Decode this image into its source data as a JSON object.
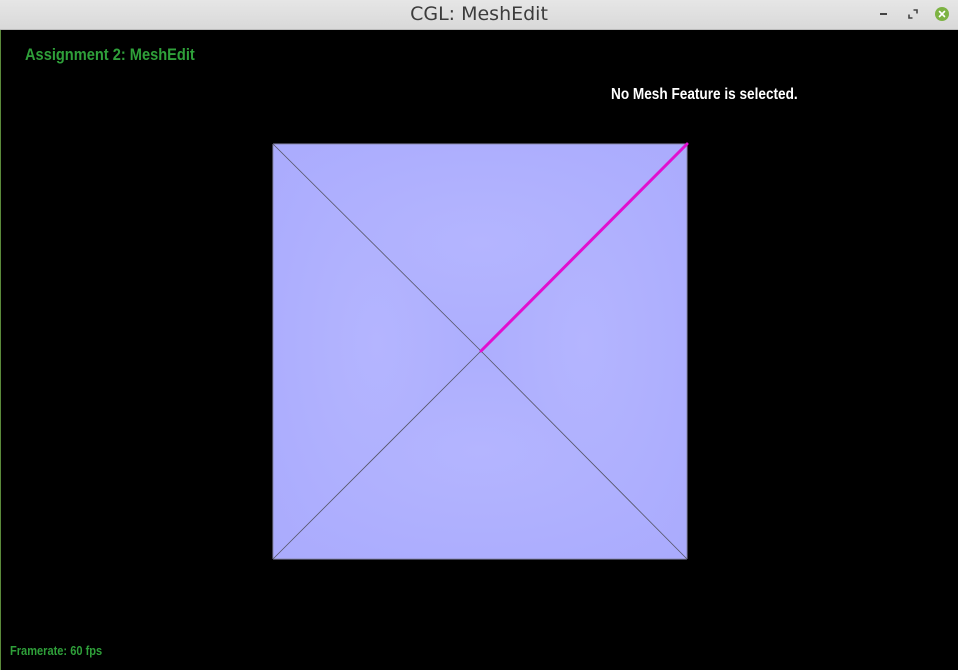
{
  "window": {
    "title": "CGL: MeshEdit"
  },
  "overlay": {
    "heading": "Assignment 2: MeshEdit",
    "status": "No Mesh Feature is selected.",
    "framerate_label": "Framerate:",
    "framerate_value": "60 fps"
  },
  "colors": {
    "face": "#afb0ff",
    "highlight_edge": "#e010d0",
    "edge": "#555566",
    "text_green": "#2fa03a"
  },
  "icons": {
    "minimize": "minimize-icon",
    "maximize": "maximize-icon",
    "close": "close-icon"
  }
}
